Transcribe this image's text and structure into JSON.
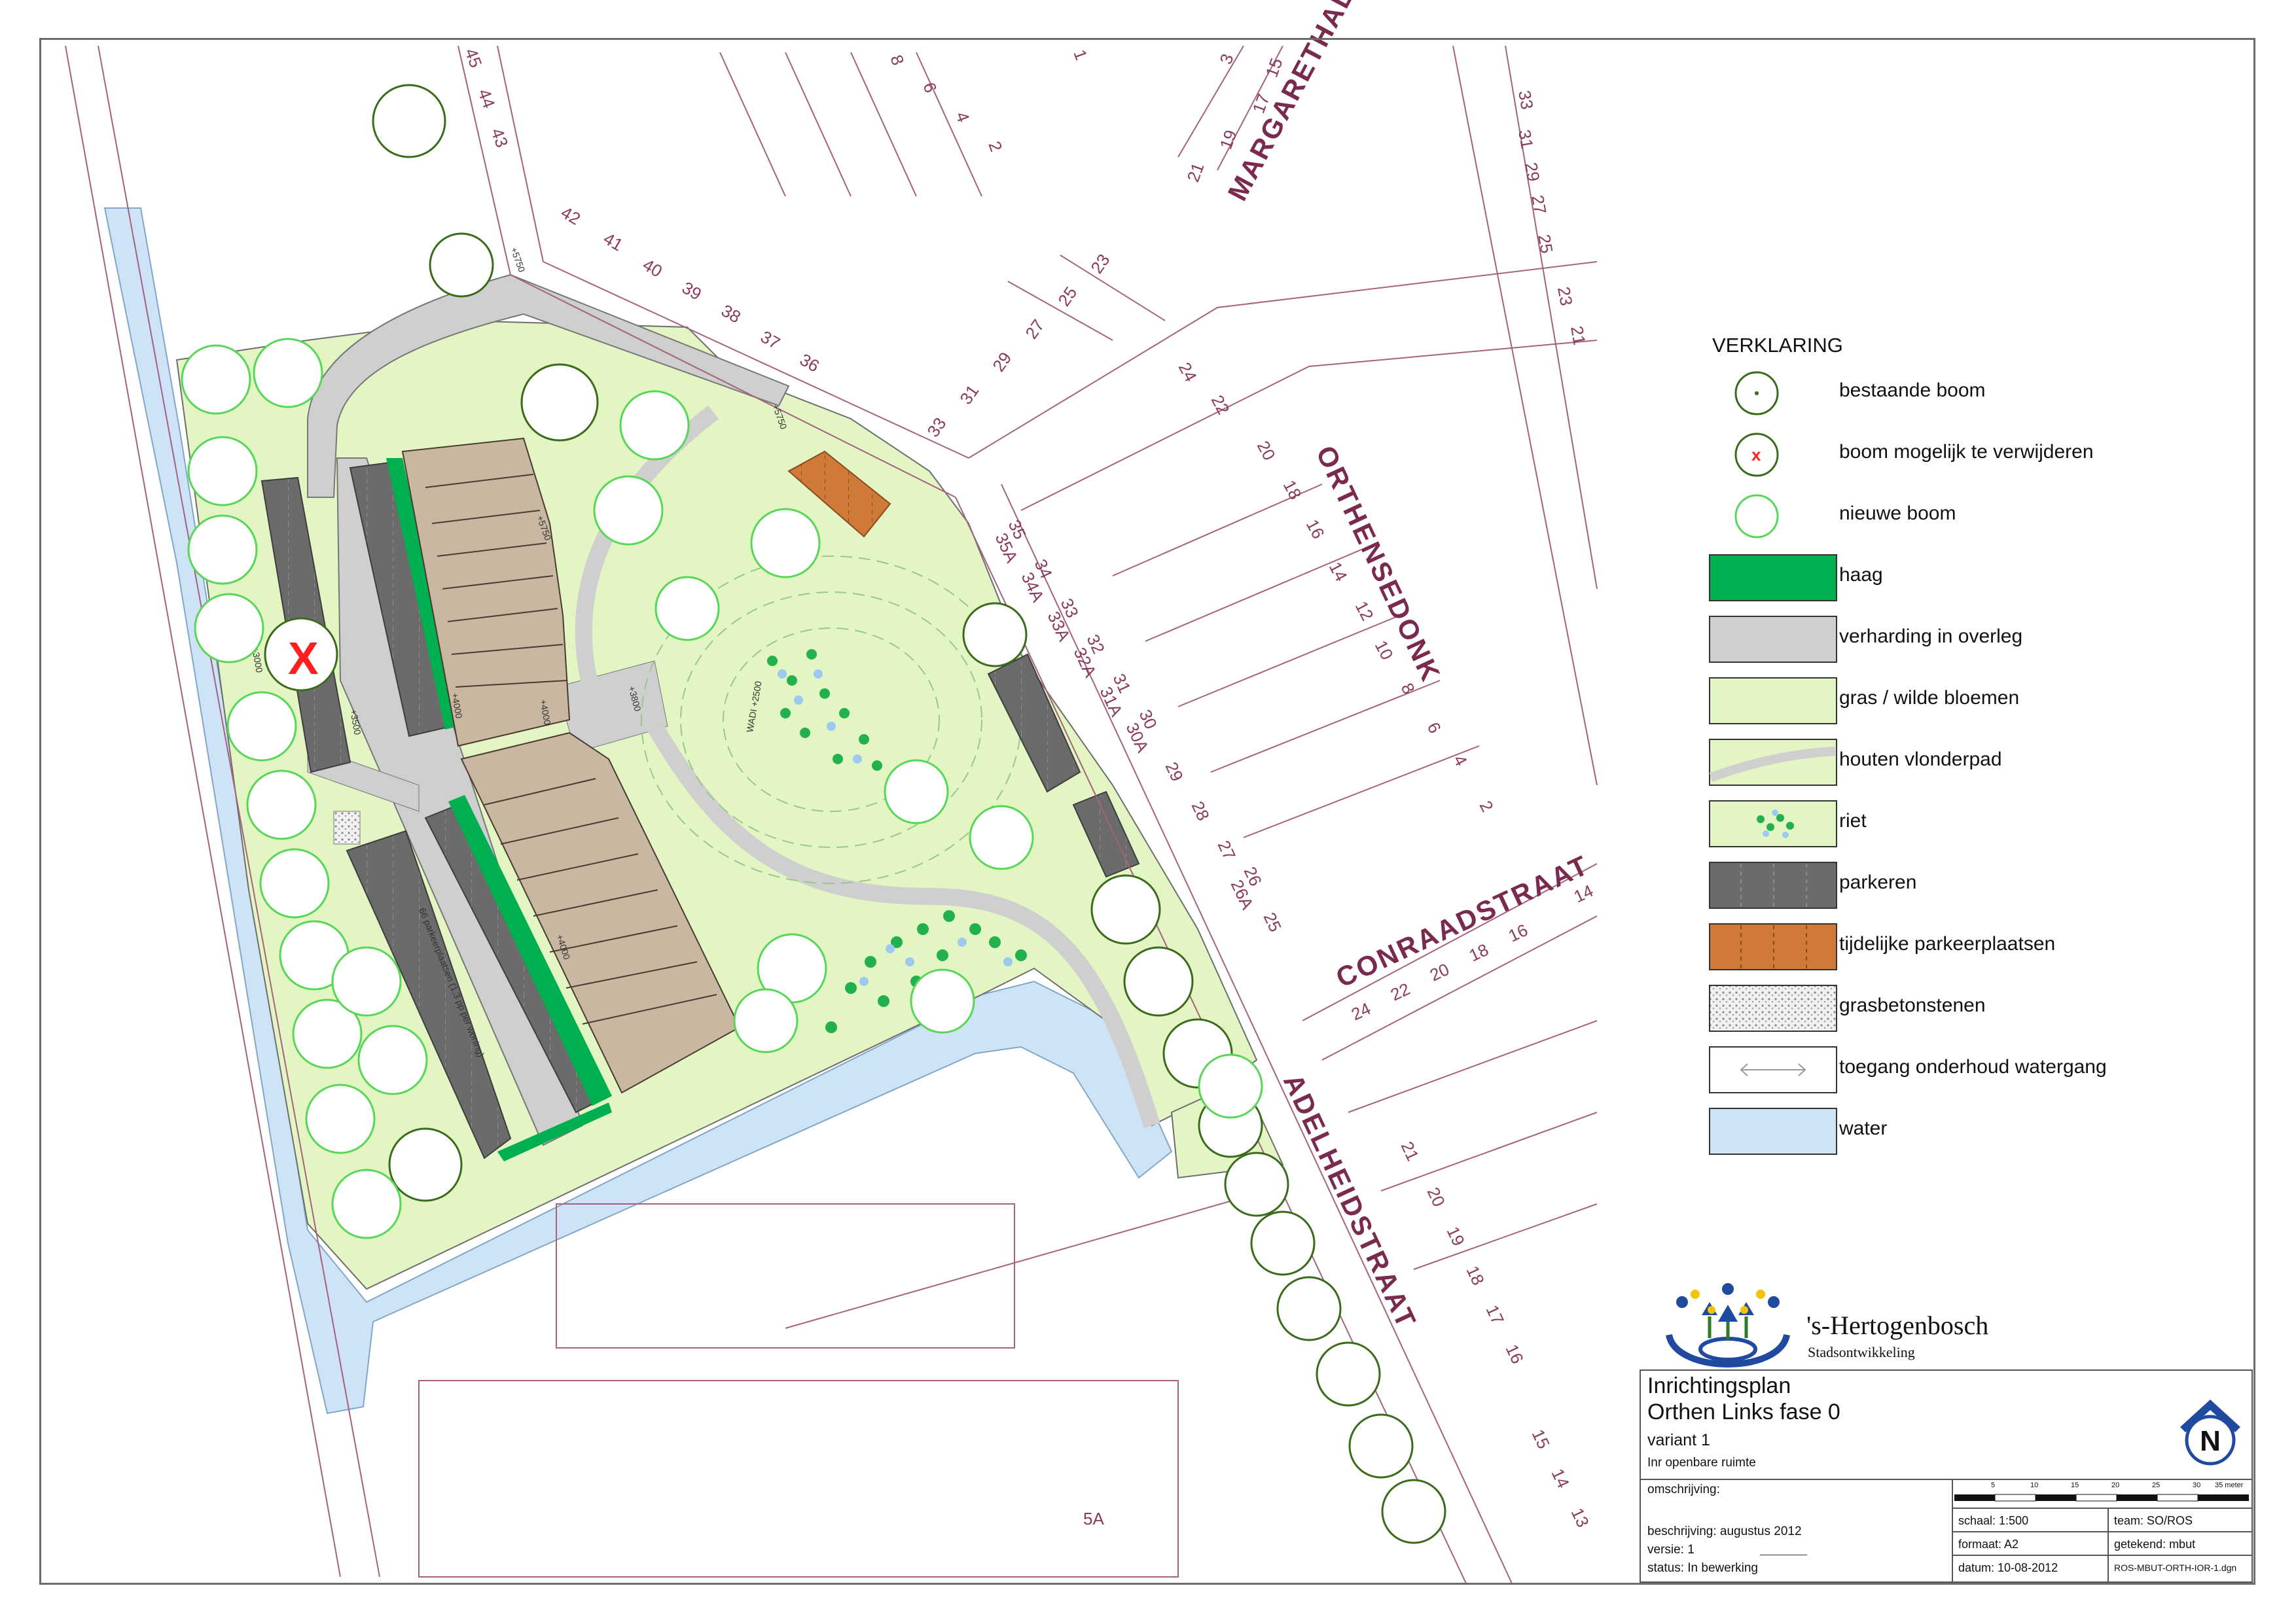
{
  "streets": {
    "margarethalaan": "MARGARETHALA",
    "orthensedonk": "ORTHENSEDONK",
    "conraadstraat": "CONRAADSTRAAT",
    "adelheidstraat": "ADELHEIDSTRAAT"
  },
  "house_numbers": {
    "north_row": [
      "45",
      "44",
      "43",
      "8",
      "6",
      "4",
      "2",
      "1",
      "3",
      "15"
    ],
    "margaretha_row": [
      "21",
      "19",
      "17"
    ],
    "middle_row": [
      "42",
      "41",
      "40",
      "39",
      "38",
      "37",
      "36"
    ],
    "middle_row2": [
      "23",
      "25",
      "27",
      "29",
      "31",
      "33"
    ],
    "right_col": [
      "33",
      "31",
      "29",
      "27",
      "25",
      "23",
      "21"
    ],
    "orthensedonk_row": [
      "24",
      "22",
      "20",
      "18",
      "16",
      "14",
      "12",
      "10",
      "8",
      "6",
      "4",
      "2"
    ],
    "adelheid_west": [
      "35",
      "35A",
      "34",
      "34A",
      "33",
      "33A",
      "32",
      "32A",
      "31",
      "31A",
      "30",
      "30A",
      "29",
      "28",
      "27",
      "26",
      "26A",
      "25"
    ],
    "conraad_row": [
      "24",
      "22",
      "20",
      "18",
      "16",
      "14"
    ],
    "adelheid_east": [
      "21",
      "20",
      "19",
      "18",
      "17",
      "16",
      "15",
      "14",
      "13"
    ],
    "block_label": "5A"
  },
  "annotations": {
    "parking_label": "66 parkeerplaatsen (1,3 pp per woning)",
    "level_5750_a": "+5750",
    "level_5750_b": "+5750",
    "level_5750_c": "+5750",
    "level_3500": "+3500",
    "level_3000": "+3000",
    "level_3800": "+3800",
    "level_4000_a": "+4000",
    "level_4000_b": "+4000",
    "level_4000_c": "+4000",
    "wadi": "WADI\n+2500"
  },
  "legend": {
    "title": "VERKLARING",
    "items": [
      {
        "label": "bestaande boom",
        "icon": "existing-tree-icon"
      },
      {
        "label": "boom mogelijk te verwijderen",
        "icon": "removable-tree-icon"
      },
      {
        "label": "nieuwe boom",
        "icon": "new-tree-icon"
      },
      {
        "label": "haag",
        "icon": "hedge-swatch"
      },
      {
        "label": "verharding in overleg",
        "icon": "paving-swatch"
      },
      {
        "label": "gras / wilde bloemen",
        "icon": "grass-swatch"
      },
      {
        "label": "houten vlonderpad",
        "icon": "boardwalk-swatch"
      },
      {
        "label": "riet",
        "icon": "reed-swatch"
      },
      {
        "label": "parkeren",
        "icon": "parking-swatch"
      },
      {
        "label": "tijdelijke parkeerplaatsen",
        "icon": "temp-parking-swatch"
      },
      {
        "label": "grasbetonstenen",
        "icon": "grass-pavers-swatch"
      },
      {
        "label": "toegang onderhoud watergang",
        "icon": "maintenance-access-swatch"
      },
      {
        "label": "water",
        "icon": "water-swatch"
      }
    ]
  },
  "logo": {
    "name": "'s-Hertogenbosch",
    "sub": "Stadsontwikkeling"
  },
  "title_block": {
    "title1": "Inrichtingsplan",
    "title2": "Orthen Links fase 0",
    "variant": "variant 1",
    "subject": "Inr openbare ruimte",
    "omschrijving": "omschrijving:",
    "beschrijving": "beschrijving:  augustus 2012",
    "versie": "versie:  1",
    "status": "status:  In bewerking",
    "scale_ticks": [
      "5",
      "10",
      "15",
      "20",
      "25",
      "30",
      "35 meter"
    ],
    "schaal": "schaal:  1:500",
    "team": "team:  SO/ROS",
    "formaat": "formaat:  A2",
    "getekend": "getekend:  mbut",
    "datum": "datum:  10-08-2012",
    "file": "ROS-MBUT-ORTH-IOR-1.dgn",
    "north_letter": "N"
  },
  "colors": {
    "grass": "#e2f5c2",
    "hedge": "#00b050",
    "paving": "#cfcfcf",
    "parking": "#6b6b6b",
    "temp_parking": "#d07a3a",
    "water": "#cfe3f6",
    "building": "#c8b8a2",
    "street_line": "#a5617e",
    "tree_existing": "#3a6b1a",
    "tree_new": "#57d657"
  }
}
